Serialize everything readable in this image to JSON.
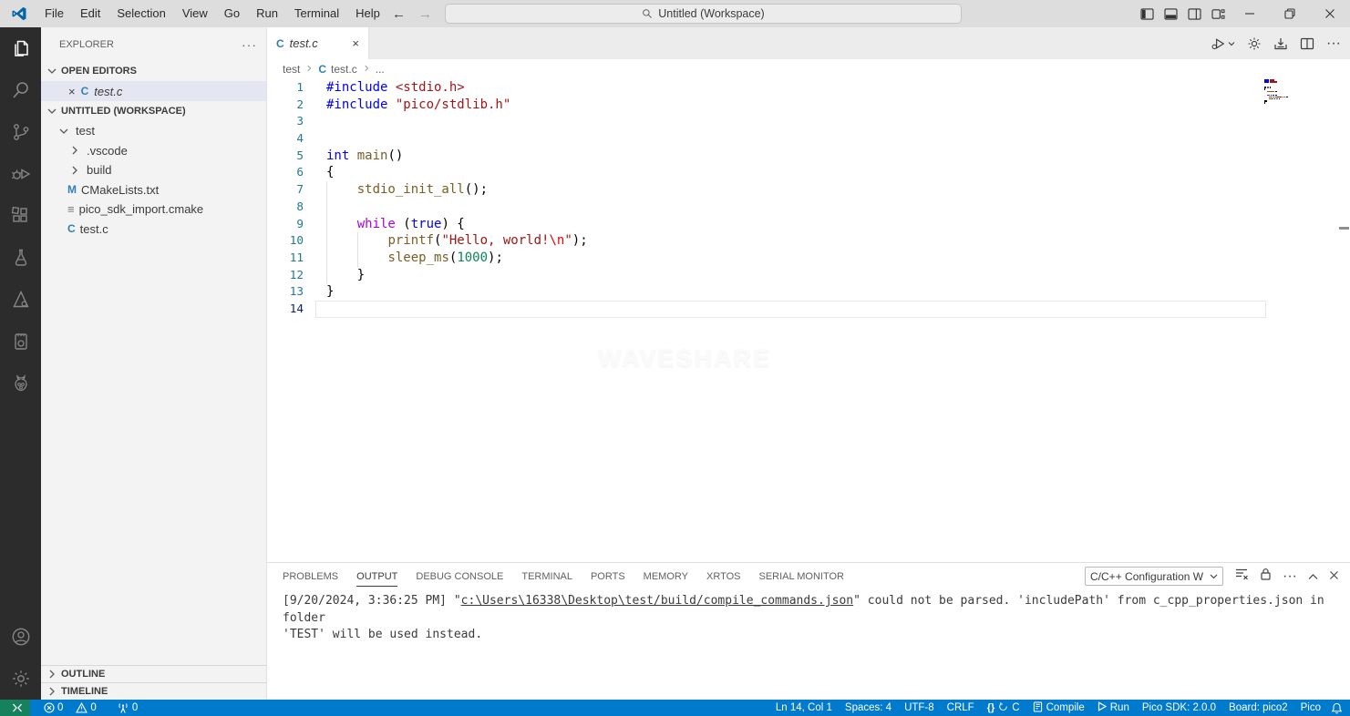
{
  "titlebar": {
    "menus": [
      "File",
      "Edit",
      "Selection",
      "View",
      "Go",
      "Run",
      "Terminal",
      "Help"
    ],
    "search_text": "Untitled (Workspace)"
  },
  "activity_bar": {
    "top": [
      {
        "name": "explorer",
        "active": true
      },
      {
        "name": "search",
        "active": false
      },
      {
        "name": "source-control",
        "active": false
      },
      {
        "name": "run-debug",
        "active": false
      },
      {
        "name": "extensions",
        "active": false
      },
      {
        "name": "testing",
        "active": false
      },
      {
        "name": "cmake",
        "active": false
      },
      {
        "name": "pico-board",
        "active": false
      },
      {
        "name": "raspberry-pi",
        "active": false
      }
    ],
    "bottom": [
      {
        "name": "account",
        "active": false
      },
      {
        "name": "settings",
        "active": false
      }
    ]
  },
  "sidebar": {
    "title": "EXPLORER",
    "open_editors_label": "OPEN EDITORS",
    "open_editor": {
      "file": "test.c"
    },
    "workspace_label": "UNTITLED (WORKSPACE)",
    "file_icon_glyphs": {
      "c-file": "C",
      "cmake-m": "M",
      "cmake-file": "≡"
    },
    "tree": [
      {
        "label": "test",
        "kind": "folder",
        "expanded": true,
        "indent": 0
      },
      {
        "label": ".vscode",
        "kind": "folder",
        "expanded": false,
        "indent": 1
      },
      {
        "label": "build",
        "kind": "folder",
        "expanded": false,
        "indent": 1
      },
      {
        "label": "CMakeLists.txt",
        "kind": "cmake-m",
        "indent": 1
      },
      {
        "label": "pico_sdk_import.cmake",
        "kind": "cmake-file",
        "indent": 1
      },
      {
        "label": "test.c",
        "kind": "c-file",
        "indent": 1
      }
    ],
    "outline_label": "OUTLINE",
    "timeline_label": "TIMELINE"
  },
  "editor": {
    "tab": {
      "label": "test.c",
      "language_icon": "C"
    },
    "breadcrumb": {
      "items": [
        "test",
        "test.c",
        "..."
      ]
    },
    "watermark": "WAVESHARE",
    "line_number_color": "#237893",
    "active_line_number_color": "#0b216f",
    "syntax_colors": {
      "directive": "#0000ff",
      "keyword": "#0000ff",
      "control": "#af00db",
      "string": "#a31515",
      "escape": "#ee0000",
      "function": "#795e26",
      "number": "#098658",
      "plain": "#000000"
    },
    "code_lines": [
      {
        "n": 1,
        "tokens": [
          {
            "t": "#include ",
            "c": "directive"
          },
          {
            "t": "<stdio.h>",
            "c": "string"
          }
        ]
      },
      {
        "n": 2,
        "tokens": [
          {
            "t": "#include ",
            "c": "directive"
          },
          {
            "t": "\"pico/stdlib.h\"",
            "c": "string"
          }
        ]
      },
      {
        "n": 3,
        "tokens": []
      },
      {
        "n": 4,
        "tokens": []
      },
      {
        "n": 5,
        "tokens": [
          {
            "t": "int ",
            "c": "keyword"
          },
          {
            "t": "main",
            "c": "function"
          },
          {
            "t": "()",
            "c": "plain"
          }
        ]
      },
      {
        "n": 6,
        "tokens": [
          {
            "t": "{",
            "c": "plain"
          }
        ]
      },
      {
        "n": 7,
        "guides": [
          0
        ],
        "tokens": [
          {
            "t": "    ",
            "c": "plain"
          },
          {
            "t": "stdio_init_all",
            "c": "function"
          },
          {
            "t": "();",
            "c": "plain"
          }
        ]
      },
      {
        "n": 8,
        "guides": [
          0
        ],
        "tokens": []
      },
      {
        "n": 9,
        "guides": [
          0
        ],
        "tokens": [
          {
            "t": "    ",
            "c": "plain"
          },
          {
            "t": "while",
            "c": "control"
          },
          {
            "t": " (",
            "c": "plain"
          },
          {
            "t": "true",
            "c": "keyword"
          },
          {
            "t": ") {",
            "c": "plain"
          }
        ]
      },
      {
        "n": 10,
        "guides": [
          0,
          4
        ],
        "tokens": [
          {
            "t": "        ",
            "c": "plain"
          },
          {
            "t": "printf",
            "c": "function"
          },
          {
            "t": "(",
            "c": "plain"
          },
          {
            "t": "\"Hello, world!",
            "c": "string"
          },
          {
            "t": "\\n",
            "c": "escape"
          },
          {
            "t": "\"",
            "c": "string"
          },
          {
            "t": ");",
            "c": "plain"
          }
        ]
      },
      {
        "n": 11,
        "guides": [
          0,
          4
        ],
        "tokens": [
          {
            "t": "        ",
            "c": "plain"
          },
          {
            "t": "sleep_ms",
            "c": "function"
          },
          {
            "t": "(",
            "c": "plain"
          },
          {
            "t": "1000",
            "c": "number"
          },
          {
            "t": ");",
            "c": "plain"
          }
        ]
      },
      {
        "n": 12,
        "guides": [
          0
        ],
        "tokens": [
          {
            "t": "    }",
            "c": "plain"
          }
        ]
      },
      {
        "n": 13,
        "tokens": [
          {
            "t": "}",
            "c": "plain"
          }
        ]
      },
      {
        "n": 14,
        "current": true,
        "tokens": []
      }
    ]
  },
  "panel": {
    "tabs": [
      "PROBLEMS",
      "OUTPUT",
      "DEBUG CONSOLE",
      "TERMINAL",
      "PORTS",
      "MEMORY",
      "XRTOS",
      "SERIAL MONITOR"
    ],
    "active_tab": "OUTPUT",
    "channel_dropdown": "C/C++ Configuration W",
    "output": {
      "line1_prefix": "[9/20/2024, 3:36:25 PM] \"",
      "link": "c:\\Users\\16338\\Desktop\\test/build/compile_commands.json",
      "line1_suffix": "\" could not be parsed. 'includePath' from c_cpp_properties.json in folder",
      "line2": "'TEST' will be used instead."
    }
  },
  "status_bar": {
    "colors": {
      "background": "#007acc",
      "remote_background": "#16825d"
    },
    "errors": "0",
    "warnings": "0",
    "ports": "0",
    "right": [
      {
        "name": "cursor-position",
        "label": "Ln 14, Col 1"
      },
      {
        "name": "indentation",
        "label": "Spaces: 4"
      },
      {
        "name": "encoding",
        "label": "UTF-8"
      },
      {
        "name": "eol",
        "label": "CRLF"
      },
      {
        "name": "language-mode",
        "label": "C",
        "icon": "braces-sync"
      },
      {
        "name": "compile",
        "label": "Compile",
        "icon": "compile"
      },
      {
        "name": "run",
        "label": "Run",
        "icon": "play"
      },
      {
        "name": "pico-sdk",
        "label": "Pico SDK: 2.0.0"
      },
      {
        "name": "board",
        "label": "Board: pico2"
      },
      {
        "name": "pico",
        "label": "Pico"
      }
    ]
  }
}
